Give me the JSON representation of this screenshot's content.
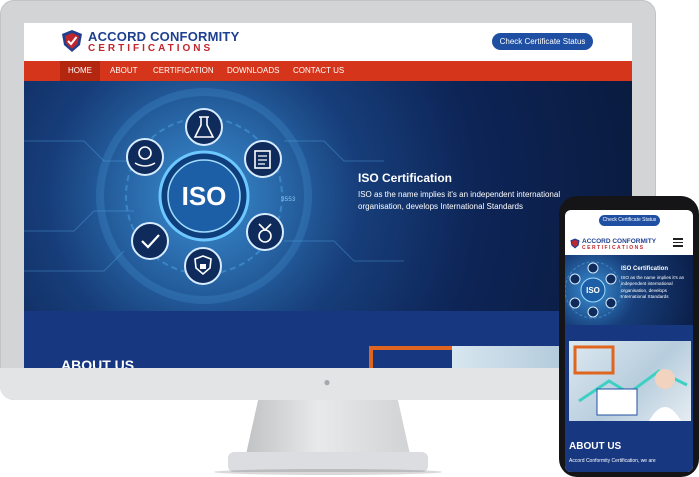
{
  "desktop": {
    "brand": {
      "name": "ACCORD CONFORMITY",
      "sub": "CERTIFICATIONS"
    },
    "check_button": "Check Certificate Status",
    "nav": [
      "HOME",
      "ABOUT",
      "CERTIFICATION",
      "DOWNLOADS",
      "CONTACT US"
    ],
    "hero": {
      "title": "ISO Certification",
      "text": "ISO as the name implies it's an independent international organisation, develops International Standards",
      "badge": "ISO",
      "code": "3553"
    },
    "about_title": "ABOUT US"
  },
  "mobile": {
    "check_button": "Check Certificate Status",
    "brand": {
      "name": "ACCORD CONFORMITY",
      "sub": "CERTIFICATIONS"
    },
    "hero": {
      "title": "ISO Certification",
      "text": "ISO as the name implies it's an independent international organisation, develops International Standards",
      "badge": "ISO"
    },
    "about_title": "ABOUT US",
    "about_text": "Accord Conformity Certification, we are"
  },
  "colors": {
    "brand_blue": "#1f3f8f",
    "brand_red": "#c0262d",
    "nav_red": "#d5351a",
    "button_blue": "#1f4fa3",
    "about_band": "#173780",
    "accent_orange": "#e0651e"
  },
  "icons": [
    "shield-logo-icon",
    "globe-hand-icon",
    "lab-flask-icon",
    "document-list-icon",
    "checkmark-icon",
    "shield-lock-icon",
    "badge-check-icon",
    "hamburger-menu-icon",
    "apple-logo-icon"
  ]
}
